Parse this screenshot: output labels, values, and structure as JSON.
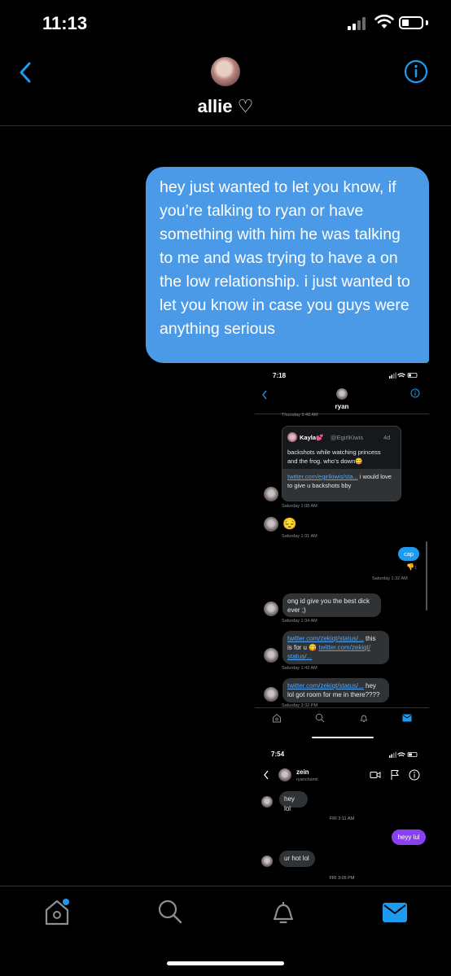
{
  "status_bar": {
    "time": "11:13"
  },
  "header": {
    "name": "allie",
    "name_suffix": "♡"
  },
  "message": {
    "text": "hey just wanted to let you know, if you’re talking to ryan or have something with him he was talking to me and was trying to have a on the low relationship. i just wanted to let you know in case you guys were anything serious"
  },
  "screenshot1": {
    "status_time": "7:18",
    "contact_name": "ryan",
    "top_timestamp": "Thursday 9:48 AM",
    "quoted_tweet": {
      "author": "Kayla💕",
      "handle": "@EgirlKiwis",
      "age": "4d",
      "text_line1": "backshots while watching princess",
      "text_line2": "and the frog. who’s down😋"
    },
    "messages": [
      {
        "link": "twitter.com/egirlkiwis/sta...",
        "text": " i would love to give u backshots bby",
        "time": "Saturday 1:08 AM"
      },
      {
        "text": "😔",
        "time": "Saturday 1:31 AM"
      },
      {
        "text": "cap",
        "time": "Saturday 1:32 AM",
        "reaction": "👎",
        "reaction_count": "1"
      },
      {
        "text_line1": "ong id give you the best dick",
        "text_line2": "ever ;)",
        "time": "Saturday 1:34 AM"
      },
      {
        "link": "twitter.com/zekiqt/status/...",
        "text_a": " this",
        "text_b": "is for u 😋 ",
        "link2": "twitter.com/zekiqt/",
        "link3": "status/...",
        "time": "Saturday 1:43 AM"
      },
      {
        "link": "twitter.com/zekiqt/status/...",
        "text_a": " hey",
        "text_b": "lol got room for me in there????",
        "time": "Saturday 3:32 PM"
      }
    ]
  },
  "screenshot2": {
    "status_time": "7:54",
    "contact_name": "zein",
    "contact_handle": "ryanchamii",
    "messages": [
      {
        "text": "hey lol",
        "time": "FRI 3:11 AM"
      },
      {
        "text": "heyy lul"
      },
      {
        "text": "ur hot lol",
        "time": "FRI 3:05 PM"
      }
    ]
  },
  "colors": {
    "accent": "#1d9bf0",
    "sent_bubble": "#4a9ae8",
    "purple_bubble": "#8a3ff3"
  },
  "tab_bar": {
    "items": [
      "home-icon",
      "search-icon",
      "notifications-icon",
      "messages-icon"
    ]
  }
}
